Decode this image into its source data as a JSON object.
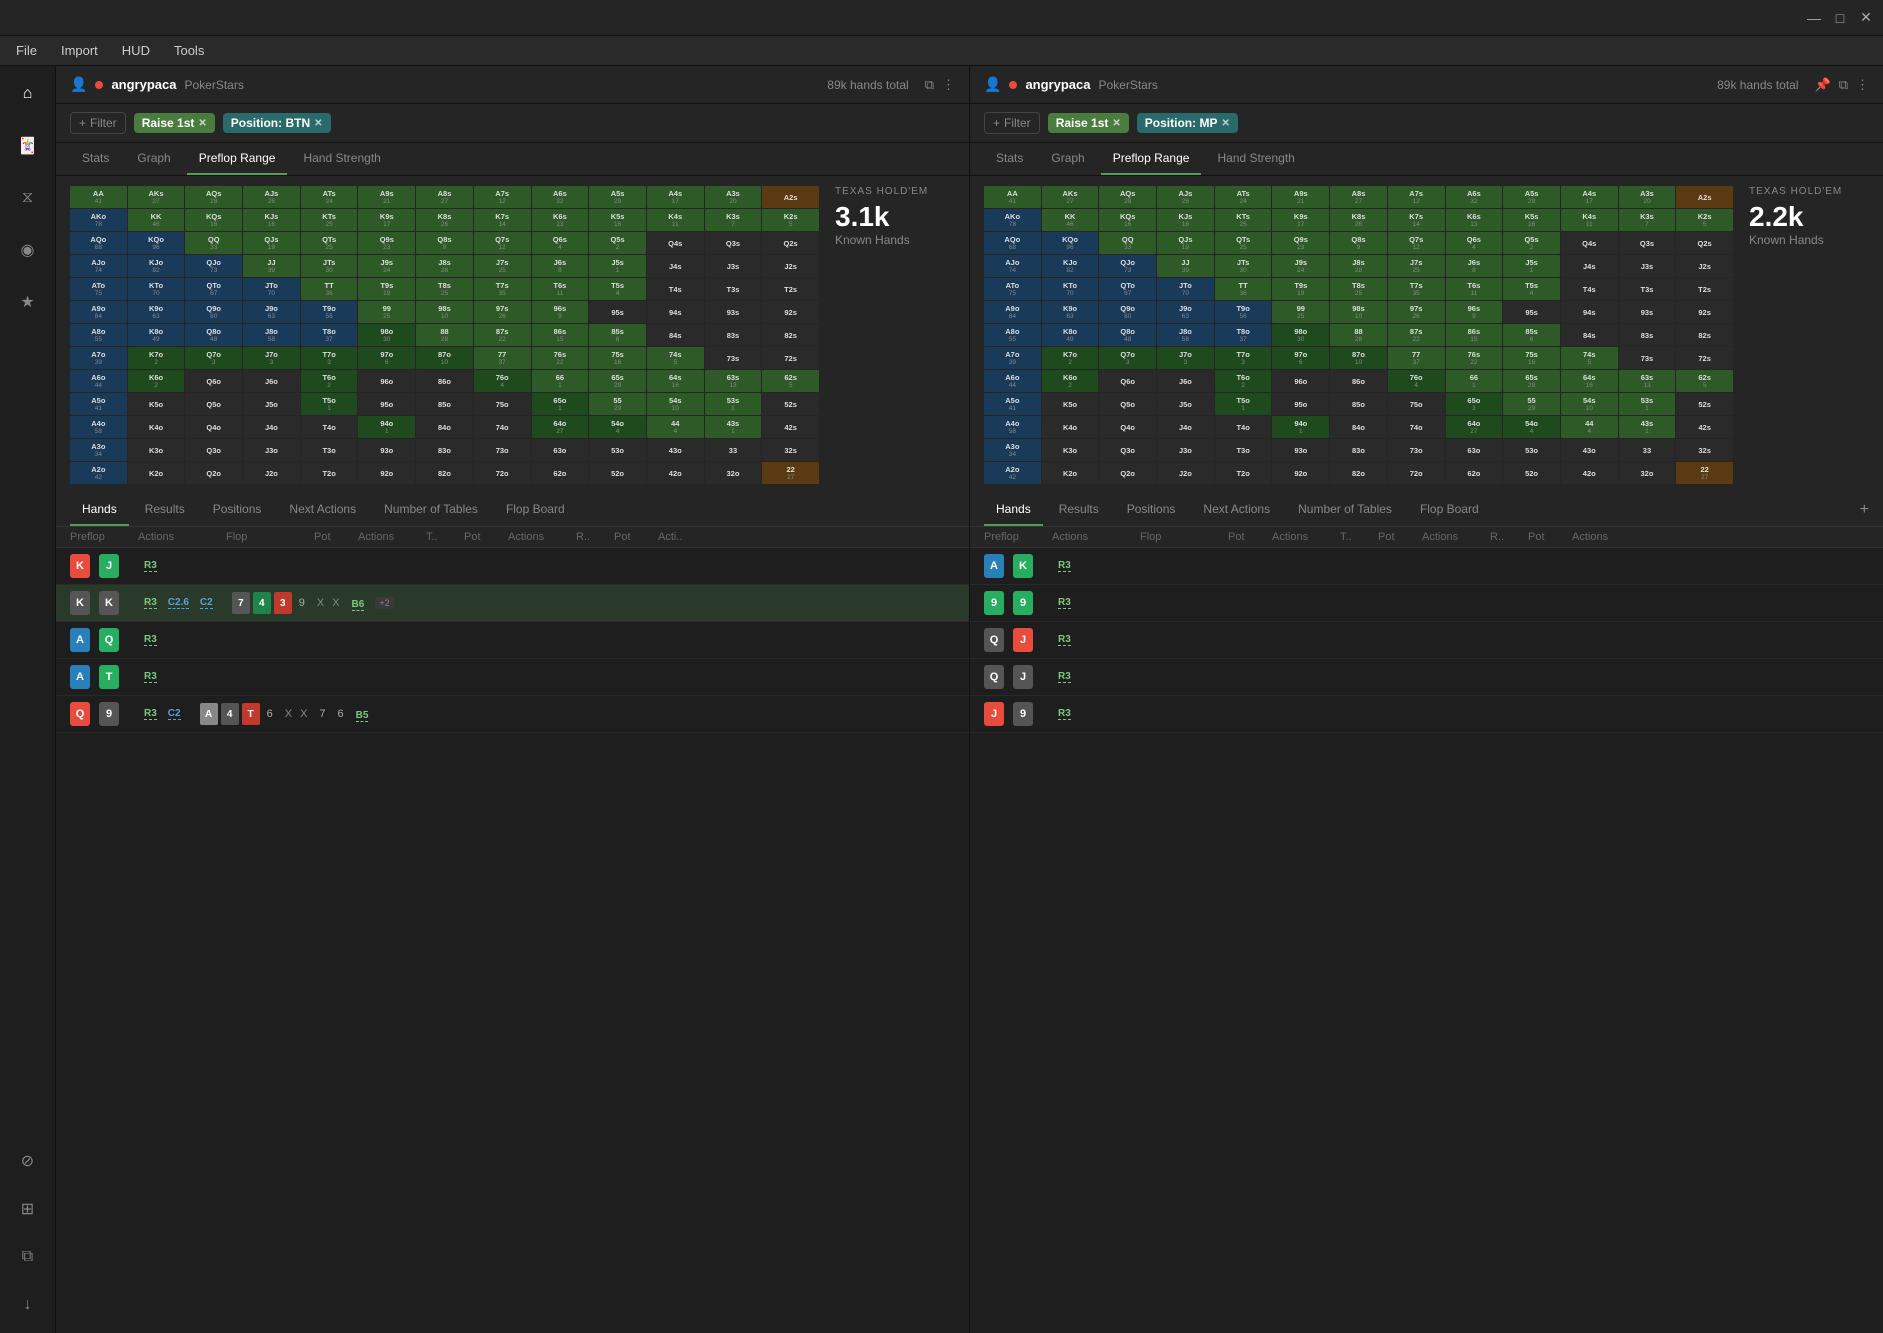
{
  "titleBar": {
    "minimize": "—",
    "maximize": "□",
    "close": "✕"
  },
  "menu": {
    "items": [
      "File",
      "Import",
      "HUD",
      "Tools"
    ]
  },
  "sidebar": {
    "icons": [
      {
        "name": "home-icon",
        "symbol": "⌂"
      },
      {
        "name": "hands-icon",
        "symbol": "🃏"
      },
      {
        "name": "graph-icon",
        "symbol": "⧖"
      },
      {
        "name": "radio-icon",
        "symbol": "◉"
      },
      {
        "name": "star-icon",
        "symbol": "★"
      },
      {
        "name": "filter-icon",
        "symbol": "⊘"
      },
      {
        "name": "table-icon",
        "symbol": "⊞"
      },
      {
        "name": "copy-icon",
        "symbol": "⧉"
      },
      {
        "name": "download-icon",
        "symbol": "↓"
      }
    ]
  },
  "panels": [
    {
      "id": "panel-left",
      "username": "angrypaca",
      "site": "PokerStars",
      "handsTotal": "89k hands total",
      "filters": [
        {
          "label": "Raise 1st",
          "type": "green"
        },
        {
          "label": "Position: BTN",
          "type": "teal"
        }
      ],
      "tabs": [
        "Stats",
        "Graph",
        "Preflop Range",
        "Hand Strength"
      ],
      "activeTab": "Preflop Range",
      "texasLabel": "TEXAS HOLD'EM",
      "knownHands": "3.1k",
      "knownHandsLabel": "Known Hands",
      "bottomTabs": [
        "Hands",
        "Results",
        "Positions",
        "Next Actions",
        "Number of Tables",
        "Flop Board"
      ],
      "activeBottomTab": "Hands",
      "tableHeaders": [
        "Preflop",
        "Actions",
        "Flop",
        "Pot",
        "Actions",
        "T..",
        "Pot",
        "Actions",
        "R..",
        "Pot",
        "Acti.."
      ],
      "hands": [
        {
          "cards": [
            {
              "val": "K",
              "suit": "red"
            },
            {
              "val": "J",
              "suit": "green"
            }
          ],
          "preflop_action": "R3",
          "flop": null,
          "flop_pot": null,
          "flop_action": null
        },
        {
          "cards": [
            {
              "val": "K",
              "suit": "gray"
            },
            {
              "val": "K",
              "suit": "gray"
            }
          ],
          "preflop_action": "R3",
          "extra_actions": "C2.6 C2",
          "flop_cards": [
            "7",
            "4",
            "3",
            "9"
          ],
          "flop_pot": null,
          "flop_action": "X X",
          "extra": "B6 +2"
        },
        {
          "cards": [
            {
              "val": "A",
              "suit": "blue"
            },
            {
              "val": "Q",
              "suit": "green"
            }
          ],
          "preflop_action": "R3"
        },
        {
          "cards": [
            {
              "val": "A",
              "suit": "blue"
            },
            {
              "val": "T",
              "suit": "green"
            }
          ],
          "preflop_action": "R3"
        },
        {
          "cards": [
            {
              "val": "Q",
              "suit": "red"
            },
            {
              "val": "9",
              "suit": "gray"
            }
          ],
          "preflop_action": "R3",
          "extra_actions": "C2",
          "flop_cards": [
            "A",
            "4",
            "T"
          ],
          "flop_num": "6",
          "flop_action": "X X",
          "extra2": "7",
          "extra3": "6",
          "extra4": "B5"
        }
      ]
    },
    {
      "id": "panel-right",
      "username": "angrypaca",
      "site": "PokerStars",
      "handsTotal": "89k hands total",
      "filters": [
        {
          "label": "Raise 1st",
          "type": "green"
        },
        {
          "label": "Position: MP",
          "type": "teal"
        }
      ],
      "tabs": [
        "Stats",
        "Graph",
        "Preflop Range",
        "Hand Strength"
      ],
      "activeTab": "Preflop Range",
      "texasLabel": "TEXAS HOLD'EM",
      "knownHands": "2.2k",
      "knownHandsLabel": "Known Hands",
      "bottomTabs": [
        "Hands",
        "Results",
        "Positions",
        "Next Actions",
        "Number of Tables",
        "Flop Board"
      ],
      "activeBottomTab": "Hands",
      "tableHeaders": [
        "Preflop",
        "Actions",
        "Flop",
        "Pot",
        "Actions",
        "T..",
        "Pot",
        "Actions",
        "R..",
        "Pot",
        "Actions"
      ],
      "hands": [
        {
          "cards": [
            {
              "val": "A",
              "suit": "blue"
            },
            {
              "val": "K",
              "suit": "green"
            }
          ],
          "preflop_action": "R3"
        },
        {
          "cards": [
            {
              "val": "9",
              "suit": "green"
            },
            {
              "val": "9",
              "suit": "green"
            }
          ],
          "preflop_action": "R3"
        },
        {
          "cards": [
            {
              "val": "Q",
              "suit": "gray"
            },
            {
              "val": "J",
              "suit": "red"
            }
          ],
          "preflop_action": "R3"
        },
        {
          "cards": [
            {
              "val": "Q",
              "suit": "gray"
            },
            {
              "val": "J",
              "suit": "gray"
            }
          ],
          "preflop_action": "R3"
        },
        {
          "cards": [
            {
              "val": "J",
              "suit": "red"
            },
            {
              "val": "9",
              "suit": "gray"
            }
          ],
          "preflop_action": "R3"
        }
      ]
    }
  ],
  "rangeGrid": {
    "rows": [
      [
        "AA",
        "AKs",
        "AQs",
        "AJs",
        "ATs",
        "A9s",
        "A8s",
        "A7s",
        "A6s",
        "A5s",
        "A4s",
        "A3s",
        "A2s"
      ],
      [
        "AKo",
        "KK",
        "KQs",
        "KJs",
        "KTs",
        "K9s",
        "K8s",
        "K7s",
        "K6s",
        "K5s",
        "K4s",
        "K3s",
        "K2s"
      ],
      [
        "AQo",
        "KQo",
        "QQ",
        "QJs",
        "QTs",
        "Q9s",
        "Q8s",
        "Q7s",
        "Q6s",
        "Q5s",
        "Q4s",
        "Q3s",
        "Q2s"
      ],
      [
        "AJo",
        "KJo",
        "QJo",
        "JJ",
        "JTs",
        "J9s",
        "J8s",
        "J7s",
        "J6s",
        "J5s",
        "J4s",
        "J3s",
        "J2s"
      ],
      [
        "ATo",
        "KTo",
        "QTo",
        "JTo",
        "TT",
        "T9s",
        "T8s",
        "T7s",
        "T6s",
        "T5s",
        "T4s",
        "T3s",
        "T2s"
      ],
      [
        "A9o",
        "K9o",
        "Q9o",
        "J9o",
        "T9o",
        "99",
        "98s",
        "97s",
        "96s",
        "95s",
        "94s",
        "93s",
        "92s"
      ],
      [
        "A8o",
        "K8o",
        "Q8o",
        "J8o",
        "T8o",
        "98o",
        "88",
        "87s",
        "86s",
        "85s",
        "84s",
        "83s",
        "82s"
      ],
      [
        "A7o",
        "K7o",
        "Q7o",
        "J7o",
        "T7o",
        "97o",
        "87o",
        "77",
        "76s",
        "75s",
        "74s",
        "73s",
        "72s"
      ],
      [
        "A6o",
        "K6o",
        "Q6o",
        "J6o",
        "T6o",
        "96o",
        "86o",
        "76o",
        "66",
        "65s",
        "64s",
        "63s",
        "62s"
      ],
      [
        "A5o",
        "K5o",
        "Q5o",
        "J5o",
        "T5o",
        "95o",
        "85o",
        "75o",
        "65o",
        "55",
        "54s",
        "53s",
        "52s"
      ],
      [
        "A4o",
        "K4o",
        "Q4o",
        "J4o",
        "T4o",
        "94o",
        "84o",
        "74o",
        "64o",
        "54o",
        "44",
        "43s",
        "42s"
      ],
      [
        "A3o",
        "K3o",
        "Q3o",
        "J3o",
        "T3o",
        "93o",
        "83o",
        "73o",
        "63o",
        "53o",
        "43o",
        "33",
        "32s"
      ],
      [
        "A2o",
        "K2o",
        "Q2o",
        "J2o",
        "T2o",
        "92o",
        "82o",
        "72o",
        "62o",
        "52o",
        "42o",
        "32o",
        "22"
      ]
    ],
    "counts": [
      [
        "41",
        "27",
        "28",
        "26",
        "24",
        "21",
        "27",
        "12",
        "32",
        "29",
        "17",
        "20",
        ""
      ],
      [
        "78",
        "46",
        "16",
        "16",
        "25",
        "17",
        "26",
        "14",
        "13",
        "16",
        "11",
        "7",
        "5"
      ],
      [
        "68",
        "96",
        "33",
        "19",
        "25",
        "23",
        "9",
        "12",
        "4",
        "2",
        "",
        "",
        ""
      ],
      [
        "74",
        "82",
        "73",
        "39",
        "30",
        "24",
        "28",
        "25",
        "8",
        "1",
        "",
        "",
        ""
      ],
      [
        "75",
        "70",
        "67",
        "70",
        "36",
        "19",
        "25",
        "35",
        "11",
        "4",
        "",
        "",
        ""
      ],
      [
        "84",
        "63",
        "80",
        "63",
        "56",
        "25",
        "10",
        "26",
        "9",
        "",
        "",
        "",
        ""
      ],
      [
        "55",
        "49",
        "48",
        "58",
        "37",
        "30",
        "28",
        "22",
        "15",
        "6",
        "",
        "",
        ""
      ],
      [
        "39",
        "2",
        "3",
        "3",
        "3",
        "6",
        "10",
        "37",
        "22",
        "16",
        "5",
        "",
        ""
      ],
      [
        "44",
        "2",
        "",
        "",
        "2",
        "",
        "",
        "4",
        "1",
        "29",
        "16",
        "13",
        "5"
      ],
      [
        "41",
        "",
        "",
        "",
        "1",
        "",
        "",
        "",
        "1",
        "29",
        "10",
        "1",
        ""
      ],
      [
        "58",
        "",
        "",
        "",
        "",
        "1",
        "",
        "",
        "27",
        "4",
        "4",
        "1",
        ""
      ],
      [
        "34",
        "",
        "",
        "",
        "",
        "",
        "",
        "",
        "",
        "",
        "",
        "",
        ""
      ],
      [
        "42",
        "",
        "",
        "",
        "",
        "",
        "",
        "",
        "",
        "",
        "",
        "",
        "27"
      ]
    ]
  }
}
